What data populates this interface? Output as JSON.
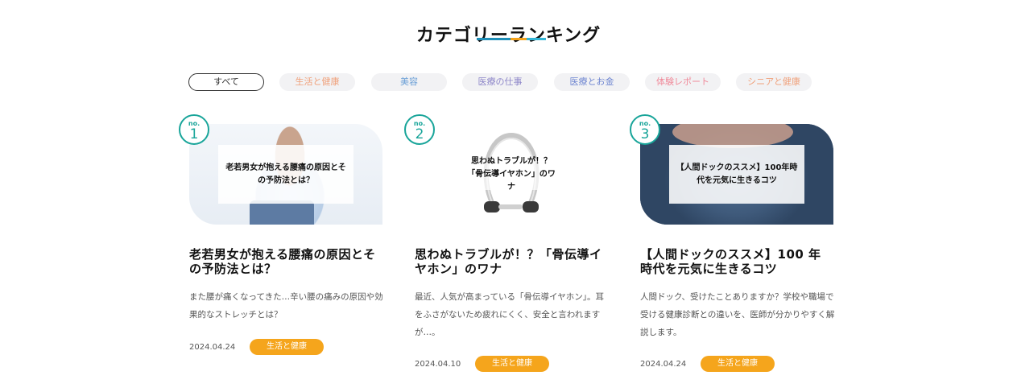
{
  "section": {
    "title": "カテゴリーランキング"
  },
  "filters": [
    {
      "label": "すべて",
      "color": "#333333"
    },
    {
      "label": "生活と健康",
      "color": "#f0a07a"
    },
    {
      "label": "美容",
      "color": "#6a9fd6"
    },
    {
      "label": "医療の仕事",
      "color": "#8d86c9"
    },
    {
      "label": "医療とお金",
      "color": "#6f86d1"
    },
    {
      "label": "体験レポート",
      "color": "#f08a9a"
    },
    {
      "label": "シニアと健康",
      "color": "#f0a07a"
    }
  ],
  "rank_label": "no.",
  "cards": [
    {
      "rank": "1",
      "overlay": "老若男女が抱える腰痛の原因とその予防法とは？",
      "title": "老若男女が抱える腰痛の原因とその予防法とは？",
      "desc": "また腰が痛くなってきた…辛い腰の痛みの原因や効果的なストレッチとは？",
      "date": "2024.04.24",
      "tag": "生活と健康"
    },
    {
      "rank": "2",
      "overlay": "思わぬトラブルが！？「骨伝導イヤホン」のワナ",
      "title": "思わぬトラブルが！？「骨伝導イヤホン」のワナ",
      "desc": "最近、人気が高まっている「骨伝導イヤホン」。耳をふさがないため疲れにくく、安全と言われますが…。",
      "date": "2024.04.10",
      "tag": "生活と健康"
    },
    {
      "rank": "3",
      "overlay": "【人間ドックのススメ】100年時代を元気に生きるコツ",
      "title": "【人間ドックのススメ】100 年時代を元気に生きるコツ",
      "desc": "人間ドック、受けたことありますか？学校や職場で受ける健康診断との違いを、医師が分かりやすく解説します。",
      "date": "2024.04.24",
      "tag": "生活と健康"
    }
  ]
}
